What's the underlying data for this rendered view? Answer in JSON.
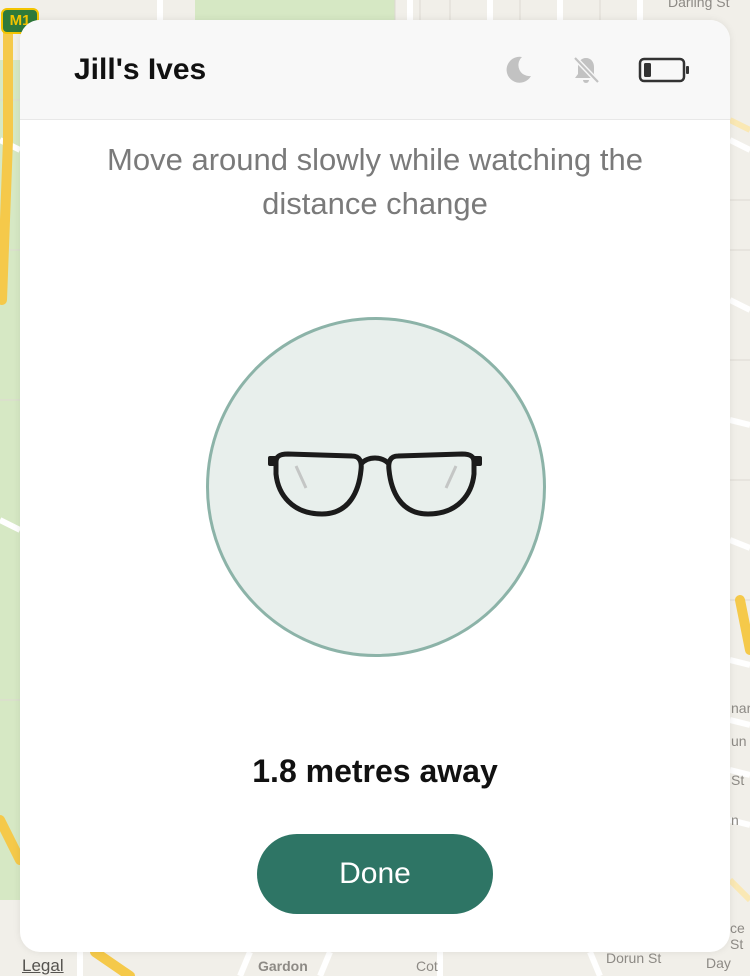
{
  "map": {
    "legal_label": "Legal",
    "motorway_badge": "M1",
    "street_labels": [
      "Darling St",
      "Gardon",
      "Cot",
      "Dorun St",
      "ce St",
      "Day",
      "nar",
      "un",
      "St",
      "n"
    ]
  },
  "card": {
    "device_name": "Jill's Ives",
    "status_icons": [
      "moon-icon",
      "bell-slash-icon",
      "battery-low-icon"
    ],
    "instructions": "Move around slowly while watching the distance change",
    "item_image": "glasses-icon",
    "distance_text": "1.8 metres away",
    "done_label": "Done"
  },
  "colors": {
    "accent": "#2e7565",
    "circle_fill": "#e8efec",
    "circle_border": "#8cb3a8",
    "status_icon": "#c2c2c2"
  }
}
